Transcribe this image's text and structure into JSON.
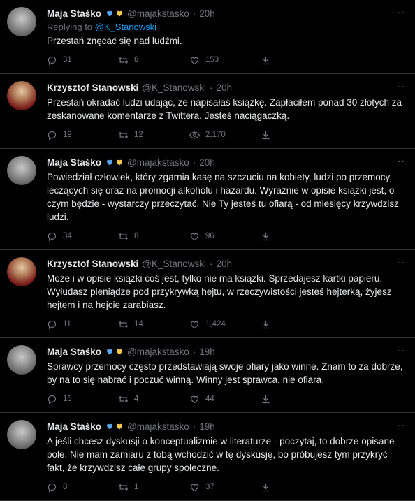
{
  "tweets": [
    {
      "author": "Maja Staśko",
      "handle": "@majakstasko",
      "time": "20h",
      "hearts": true,
      "replying_prefix": "Replying to",
      "replying_to": "@K_Stanowski",
      "text": "Przestań znęcać się nad ludźmi.",
      "replies": "31",
      "retweets": "8",
      "likes": "153"
    },
    {
      "author": "Krzysztof Stanowski",
      "handle": "@K_Stanowski",
      "time": "20h",
      "hearts": false,
      "text": "Przestań okradać ludzi udając, że napisałaś książkę. Zapłaciłem ponad 30 złotych za zeskanowane komentarze z Twittera. Jesteś naciągaczką.",
      "replies": "19",
      "retweets": "12",
      "likes": "2,170"
    },
    {
      "author": "Maja Staśko",
      "handle": "@majakstasko",
      "time": "20h",
      "hearts": true,
      "text": "Powiedział człowiek, który zgarnia kasę na szczuciu na kobiety, ludzi po przemocy, leczących się oraz na promocji alkoholu i hazardu. Wyraźnie w opisie książki jest, o czym będzie - wystarczy przeczytać. Nie Ty jesteś tu ofiarą - od miesięcy krzywdzisz ludzi.",
      "replies": "34",
      "retweets": "8",
      "likes": "96"
    },
    {
      "author": "Krzysztof Stanowski",
      "handle": "@K_Stanowski",
      "time": "20h",
      "hearts": false,
      "text": "Może i w opisie książki coś jest, tylko nie ma książki. Sprzedajesz kartki papieru. Wyłudasz pieniądze pod przykrywką hejtu, w rzeczywistości jesteś hejterką, żyjesz hejtem i na hejcie zarabiasz.",
      "replies": "11",
      "retweets": "14",
      "likes": "1,424"
    },
    {
      "author": "Maja Staśko",
      "handle": "@majakstasko",
      "time": "19h",
      "hearts": true,
      "text": "Sprawcy przemocy często przedstawiają swoje ofiary jako winne. Znam to za dobrze, by na to się nabrać i poczuć winną. Winny jest sprawca, nie ofiara.",
      "replies": "16",
      "retweets": "4",
      "likes": "44"
    },
    {
      "author": "Maja Staśko",
      "handle": "@majakstasko",
      "time": "19h",
      "hearts": true,
      "text": "A jeśli chcesz dyskusji o konceptualizmie w literaturze - poczytaj, to dobrze opisane pole. Nie mam zamiaru z tobą wchodzić w tę dyskusję, bo próbujesz tym przykryć fakt, że krzywdzisz całe grupy społeczne.",
      "replies": "8",
      "retweets": "1",
      "likes": "37"
    }
  ],
  "separator": "·",
  "more_icon": "···",
  "colors": {
    "background": "#000000",
    "text": "#e7e9ea",
    "muted": "#71767b",
    "link": "#1d9bf0",
    "blue_heart": "#5ba4f0",
    "yellow_heart": "#f5c84c"
  }
}
